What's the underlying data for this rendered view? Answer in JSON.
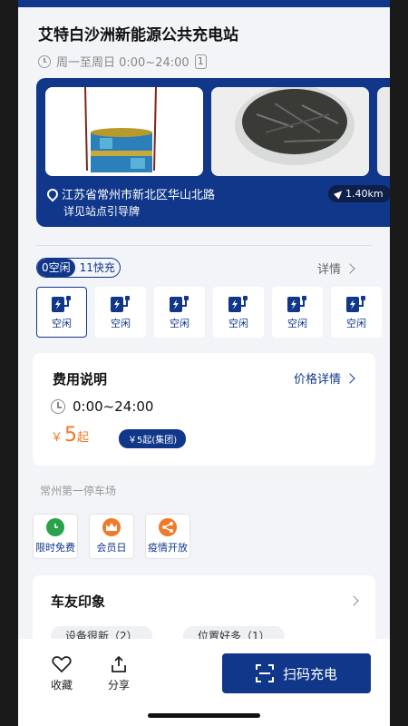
{
  "station": {
    "title": "艾特白沙洲新能源公共充电站",
    "hours": "周一至周日 0:00~24:00",
    "hours_badge": "1"
  },
  "hero": {
    "address": "江苏省常州市新北区华山北路",
    "guide": "详见站点引导牌",
    "distance": "1.40km"
  },
  "filter": {
    "idle": "0空闲",
    "fast": "11快充",
    "detail": "详情"
  },
  "chargers": [
    {
      "label": "空闲"
    },
    {
      "label": "空闲"
    },
    {
      "label": "空闲"
    },
    {
      "label": "空闲"
    },
    {
      "label": "空闲"
    },
    {
      "label": "空闲"
    }
  ],
  "fee": {
    "title": "费用说明",
    "price_link": "价格详情",
    "time": "0:00~24:00",
    "currency": "￥",
    "price": "5",
    "price_unit": "起",
    "group_price": "￥5起(集团)"
  },
  "lot_name": "常州第一停车场",
  "features": [
    {
      "label": "限时免费",
      "color": "#2aa24a",
      "icon": "clock-icon"
    },
    {
      "label": "会员日",
      "color": "#f07a27",
      "icon": "crown-icon"
    },
    {
      "label": "疫情开放",
      "color": "#f07a27",
      "icon": "share-icon"
    }
  ],
  "impression": {
    "title": "车友印象",
    "tags": [
      "设备很新（2）",
      "位置好多（1）"
    ]
  },
  "bottom": {
    "favorite": "收藏",
    "share": "分享",
    "scan": "扫码充电"
  },
  "colors": {
    "brand": "#10378a",
    "price": "#f07a27"
  }
}
